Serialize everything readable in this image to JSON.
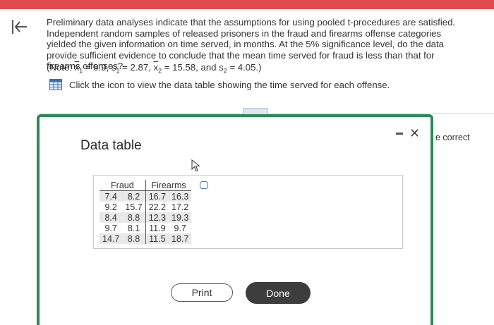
{
  "question": {
    "text": "Preliminary data analyses indicate that the assumptions for using pooled t-procedures are satisfied. Independent random samples of released prisoners in the fraud and firearms offense categories yielded the given information on time served, in months. At the 5% significance level, do the data provide sufficient evidence to conclude that the mean time served for fraud is less than that for firearms offenses?",
    "note_prefix": "(Note: ",
    "x1_sym": "x",
    "x1_sub": "1",
    "x1_val": " = 9.9, ",
    "s1_sym": "s",
    "s1_sub": "1",
    "s1_val": " = 2.87, ",
    "x2_sym": "x",
    "x2_sub": "2",
    "x2_val": " = 15.58, and ",
    "s2_sym": "s",
    "s2_sub": "2",
    "s2_val": " = 4.05.)",
    "hint": "Click the icon to view the data table showing the time served for each offense."
  },
  "right_partial": "e correct",
  "dialog": {
    "title": "Data table",
    "minimize_label": "–",
    "close_label": "✕",
    "print_label": "Print",
    "done_label": "Done"
  },
  "table": {
    "headers": [
      "Fraud",
      "Firearms"
    ],
    "rows": [
      [
        "7.4",
        "8.2",
        "16.7",
        "16.3"
      ],
      [
        "9.2",
        "15.7",
        "22.2",
        "17.2"
      ],
      [
        "8.4",
        "8.8",
        "12.3",
        "19.3"
      ],
      [
        "9.7",
        "8.1",
        "11.9",
        "9.7"
      ],
      [
        "14.7",
        "8.8",
        "11.5",
        "18.7"
      ]
    ]
  },
  "icons": [
    "back-arrow-icon",
    "table-icon",
    "copy-icon",
    "cursor-icon"
  ],
  "colors": {
    "topbar": "#e34a4f",
    "dialog_border": "#2d8a5a",
    "done_bg": "#3d3d3d"
  }
}
